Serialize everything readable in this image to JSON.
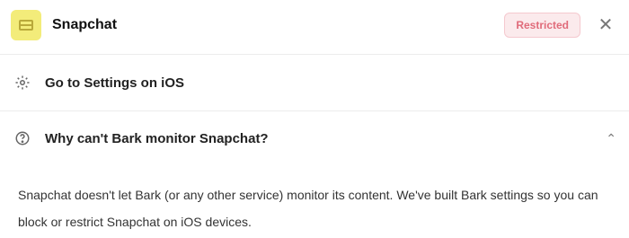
{
  "header": {
    "title": "Snapchat",
    "badge": "Restricted",
    "close_glyph": "✕",
    "app_icon": "snapchat-app-icon"
  },
  "rows": [
    {
      "label": "Go to Settings on iOS",
      "icon": "gear-icon"
    },
    {
      "label": "Why can't Bark monitor Snapchat?",
      "icon": "help-icon",
      "chevron": "⌃"
    }
  ],
  "body_text": "Snapchat doesn't let Bark (or any other service) monitor its content. We've built Bark settings so you can block or restrict Snapchat on iOS devices.",
  "colors": {
    "badge_bg": "#fbeaec",
    "badge_text": "#e06b7a",
    "app_icon_bg": "#f3ec7a"
  }
}
